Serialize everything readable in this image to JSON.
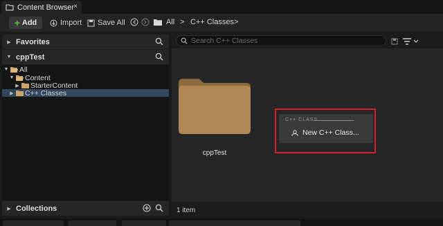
{
  "window": {
    "tab_title": "Content Browser",
    "tab_close": "×"
  },
  "toolbar": {
    "add_label": "Add",
    "add_plus": "+",
    "import_label": "Import",
    "save_all_label": "Save All",
    "breadcrumbs": [
      "All",
      "C++ Classes"
    ],
    "separator": ">"
  },
  "left_panel": {
    "favorites_label": "Favorites",
    "project_label": "cppTest",
    "collections_label": "Collections",
    "tree": [
      {
        "label": "All",
        "expanded": true,
        "selected": false
      },
      {
        "label": "Content",
        "expanded": true,
        "selected": false
      },
      {
        "label": "StarterContent",
        "expanded": false,
        "selected": false
      },
      {
        "label": "C++ Classes",
        "expanded": false,
        "selected": true
      }
    ]
  },
  "right_panel": {
    "search_placeholder": "Search C++ Classes",
    "folder_label": "cppTest",
    "status_text": "1 item",
    "cpp_menu": {
      "header": "C++ CLASS",
      "item_label": "New C++ Class..."
    }
  },
  "colors": {
    "accent_green": "#5fc44a",
    "highlight_red": "#d3232a",
    "folder_tan": "#b08755",
    "selection_blue": "#33475c"
  }
}
